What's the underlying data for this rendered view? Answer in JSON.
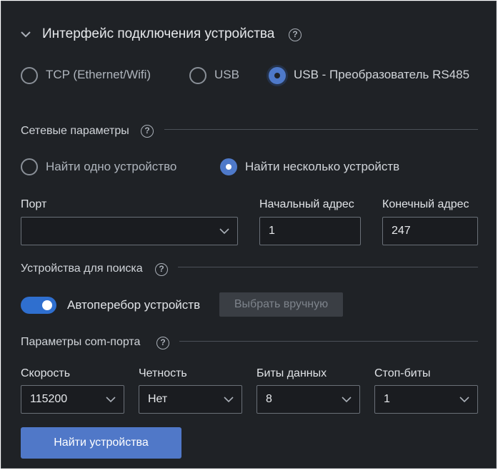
{
  "header": {
    "title": "Интерфейс подключения устройства",
    "help_icon": "question-circle-icon",
    "collapse_icon": "chevron-down-icon"
  },
  "interface": {
    "options": [
      {
        "label": "TCP (Ethernet/Wifi)",
        "selected": false
      },
      {
        "label": "USB",
        "selected": false
      },
      {
        "label": "USB - Преобразователь RS485",
        "selected": true
      }
    ]
  },
  "network": {
    "title": "Сетевые параметры",
    "search_modes": [
      {
        "label": "Найти одно устройство",
        "selected": false
      },
      {
        "label": "Найти несколько устройств",
        "selected": true
      }
    ],
    "port_label": "Порт",
    "port_value": "",
    "start_address_label": "Начальный адрес",
    "start_address_value": "1",
    "end_address_label": "Конечный адрес",
    "end_address_value": "247"
  },
  "devices": {
    "title": "Устройства для поиска",
    "auto_label": "Автоперебор устройств",
    "auto_enabled": true,
    "manual_button": "Выбрать вручную"
  },
  "com_port": {
    "title": "Параметры com-порта",
    "speed_label": "Скорость",
    "speed_value": "115200",
    "parity_label": "Четность",
    "parity_value": "Нет",
    "data_bits_label": "Биты данных",
    "data_bits_value": "8",
    "stop_bits_label": "Стоп-биты",
    "stop_bits_value": "1"
  },
  "actions": {
    "find_button": "Найти устройства"
  },
  "colors": {
    "background": "#1f2226",
    "accent": "#4e79c9",
    "primary_button": "#5078c8",
    "toggle_on": "#2f6fcf"
  }
}
